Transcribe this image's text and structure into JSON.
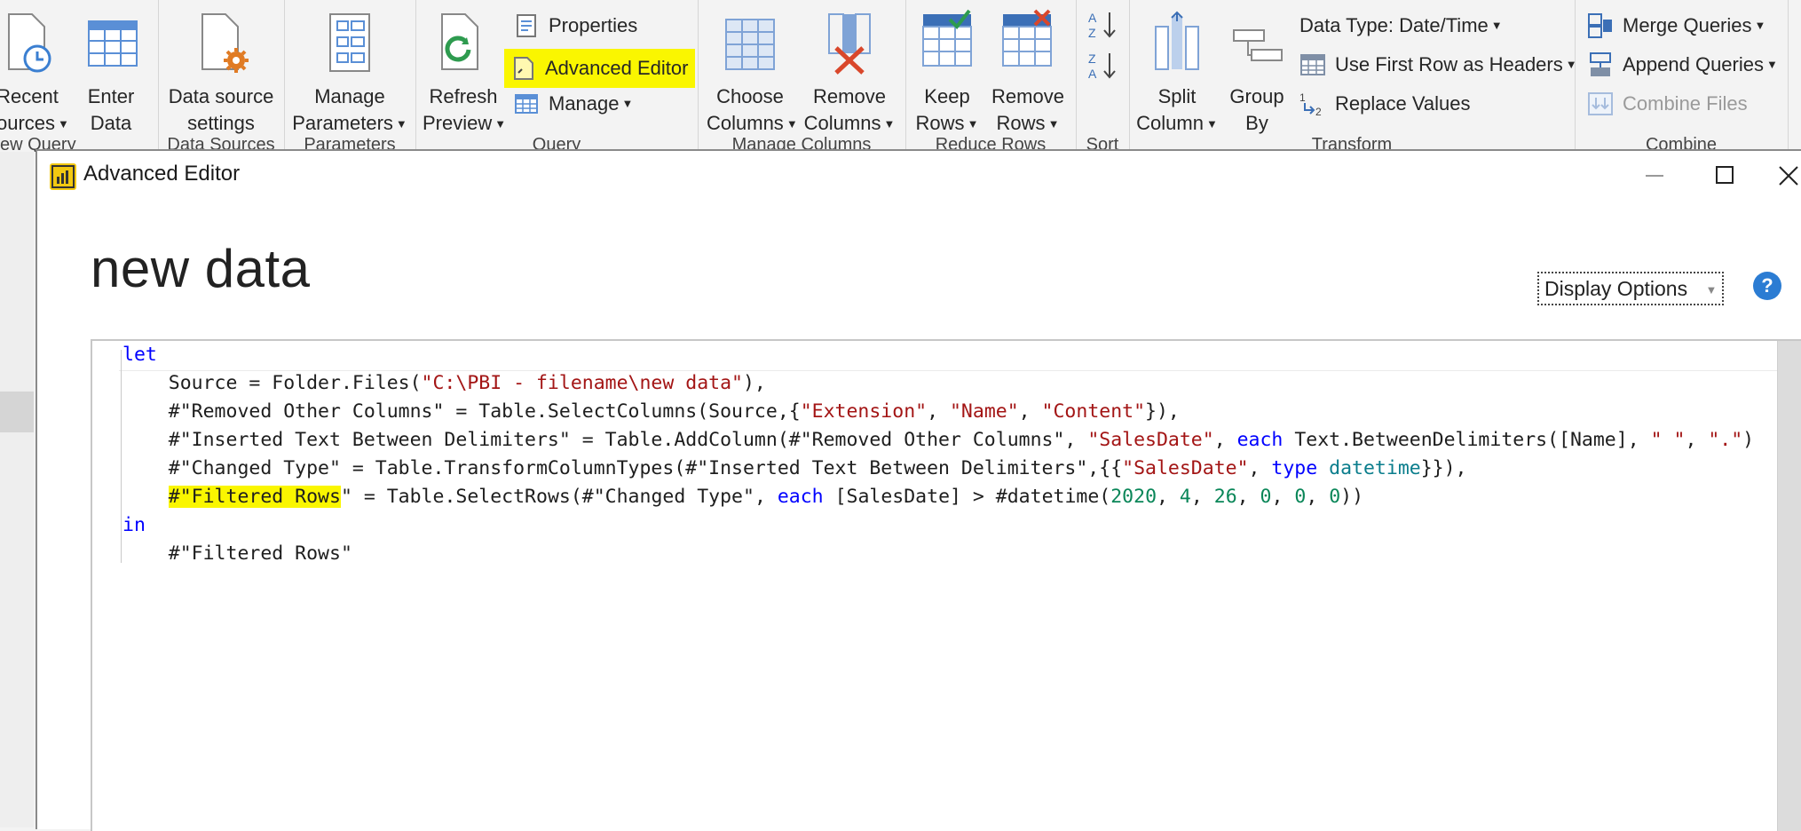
{
  "ribbon": {
    "new_query_group": {
      "label": "ew Query",
      "recent_sources": {
        "line1": "Recent",
        "line2": "ources"
      },
      "enter_data": {
        "line1": "Enter",
        "line2": "Data"
      }
    },
    "data_sources_group": {
      "label": "Data Sources",
      "data_source_settings": {
        "line1": "Data source",
        "line2": "settings"
      }
    },
    "parameters_group": {
      "label": "Parameters",
      "manage_parameters": {
        "line1": "Manage",
        "line2": "Parameters"
      }
    },
    "query_group": {
      "label": "Query",
      "refresh_preview": {
        "line1": "Refresh",
        "line2": "Preview"
      },
      "properties": "Properties",
      "advanced_editor": "Advanced Editor",
      "manage": "Manage"
    },
    "manage_columns_group": {
      "label": "Manage Columns",
      "choose_columns": {
        "line1": "Choose",
        "line2": "Columns"
      },
      "remove_columns": {
        "line1": "Remove",
        "line2": "Columns"
      }
    },
    "reduce_rows_group": {
      "label": "Reduce Rows",
      "keep_rows": {
        "line1": "Keep",
        "line2": "Rows"
      },
      "remove_rows": {
        "line1": "Remove",
        "line2": "Rows"
      }
    },
    "sort_group": {
      "label": "Sort"
    },
    "transform_group": {
      "label": "Transform",
      "split_column": {
        "line1": "Split",
        "line2": "Column"
      },
      "group_by": {
        "line1": "Group",
        "line2": "By"
      },
      "data_type": "Data Type: Date/Time",
      "use_first_row": "Use First Row as Headers",
      "replace_values": "Replace Values"
    },
    "combine_group": {
      "label": "Combine",
      "merge_queries": "Merge Queries",
      "append_queries": "Append Queries",
      "combine_files": "Combine Files"
    }
  },
  "editor": {
    "window_title": "Advanced Editor",
    "doc_title": "new data",
    "display_options": "Display Options",
    "help": "?",
    "code": {
      "l1_let": "let",
      "l2": {
        "a": "    Source = Folder.Files(",
        "b": "\"C:\\PBI - filename\\new data\"",
        "c": "),"
      },
      "l3": {
        "a": "    #\"Removed Other Columns\" = Table.SelectColumns(Source,{",
        "b": "\"Extension\"",
        "c": ", ",
        "d": "\"Name\"",
        "e": ", ",
        "f": "\"Content\"",
        "g": "}),"
      },
      "l4": {
        "a": "    #\"Inserted Text Between Delimiters\" = Table.AddColumn(#\"Removed Other Columns\", ",
        "b": "\"SalesDate\"",
        "c": ", ",
        "d": "each",
        "e": " Text.BetweenDelimiters([Name], ",
        "f": "\" \"",
        "g": ", ",
        "h": "\".\"",
        "i": ")"
      },
      "l5": {
        "a": "    #\"Changed Type\" = Table.TransformColumnTypes(#\"Inserted Text Between Delimiters\",{{",
        "b": "\"SalesDate\"",
        "c": ", ",
        "d": "type",
        "e": " ",
        "f": "datetime",
        "g": "}}),"
      },
      "l6": {
        "indent": "    ",
        "mark": "#\"Filtered Rows",
        "a": "\" = Table.SelectRows(#\"Changed Type\", ",
        "b": "each",
        "c": " [SalesDate] > #datetime(",
        "n1": "2020",
        "s1": ", ",
        "n2": "4",
        "s2": ", ",
        "n3": "26",
        "s3": ", ",
        "n4": "0",
        "s4": ", ",
        "n5": "0",
        "s5": ", ",
        "n6": "0",
        "end": "))"
      },
      "l7_in": "in",
      "l8": "    #\"Filtered Rows\""
    }
  },
  "colors": {
    "highlight": "#faf600",
    "keyword": "#0000ff",
    "string": "#a31515",
    "number": "#098658",
    "type": "#0a7d8c",
    "accent": "#2b7cd3",
    "powerbi": "#f2c811"
  }
}
